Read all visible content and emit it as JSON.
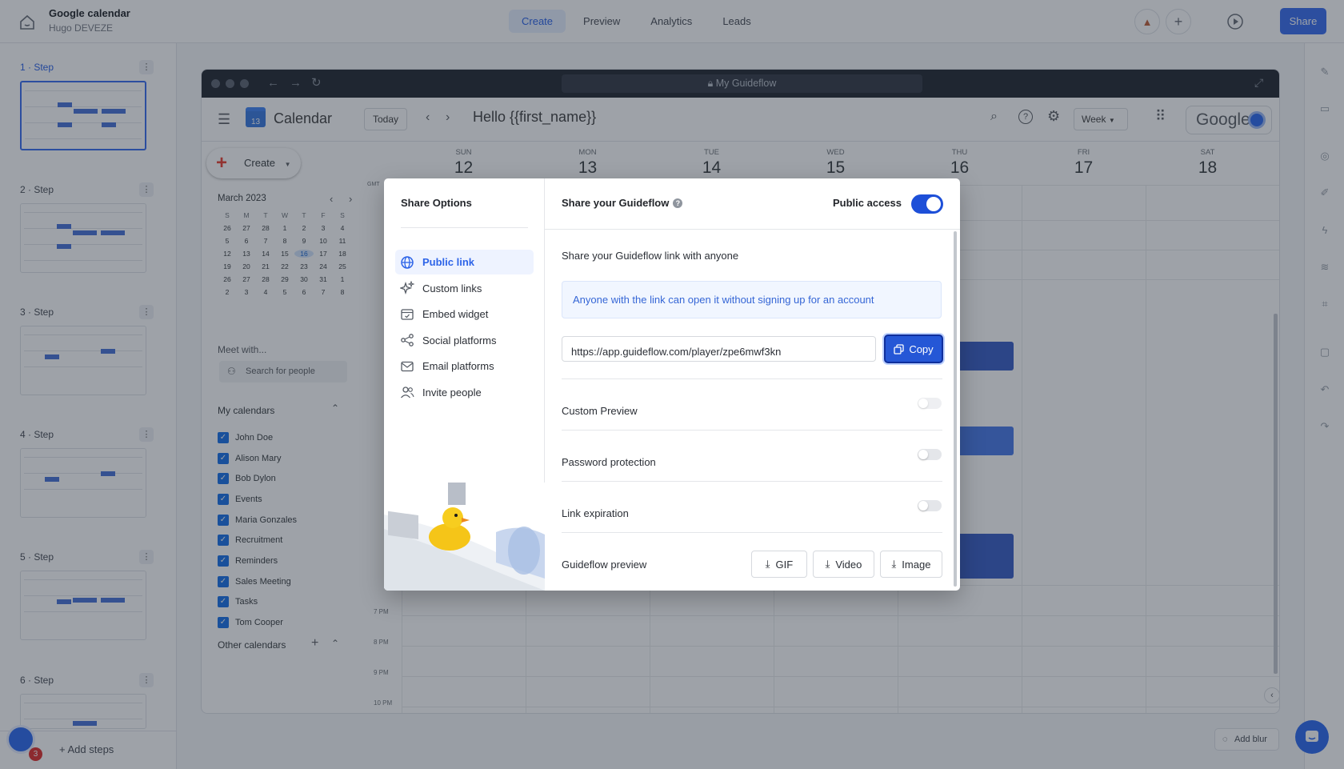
{
  "app": {
    "title": "Google calendar",
    "author": "Hugo DEVEZE"
  },
  "nav": {
    "tabs": [
      {
        "label": "Create"
      },
      {
        "label": "Preview"
      },
      {
        "label": "Analytics"
      },
      {
        "label": "Leads"
      }
    ],
    "active_tab": "Create"
  },
  "toolbar": {
    "share_label": "Share"
  },
  "steps": {
    "items": [
      {
        "label": "1 · Step"
      },
      {
        "label": "2 · Step"
      },
      {
        "label": "3 · Step"
      },
      {
        "label": "4 · Step"
      },
      {
        "label": "5 · Step"
      },
      {
        "label": "6 · Step"
      }
    ],
    "active_index": 0,
    "add_label": "+ Add steps",
    "notification_count": "3"
  },
  "browser": {
    "url": "My Guideflow"
  },
  "calendar": {
    "app_name": "Calendar",
    "today_label": "Today",
    "heading": "Hello {{first_name}}",
    "view_label": "Week",
    "brand": "Google",
    "create_label": "Create",
    "month_label": "March 2023",
    "weekday_initials": [
      "S",
      "M",
      "T",
      "W",
      "T",
      "F",
      "S"
    ],
    "mini_days": [
      "26",
      "27",
      "28",
      "1",
      "2",
      "3",
      "4",
      "5",
      "6",
      "7",
      "8",
      "9",
      "10",
      "11",
      "12",
      "13",
      "14",
      "15",
      "16",
      "17",
      "18",
      "19",
      "20",
      "21",
      "22",
      "23",
      "24",
      "25",
      "26",
      "27",
      "28",
      "29",
      "30",
      "31",
      "1",
      "2",
      "3",
      "4",
      "5",
      "6",
      "7",
      "8"
    ],
    "today_mini": "16",
    "meet_label": "Meet with...",
    "search_people_placeholder": "Search for people",
    "my_calendars_label": "My calendars",
    "calendars": [
      "John Doe",
      "Alison Mary",
      "Bob Dylon",
      "Events",
      "Maria Gonzales",
      "Recruitment",
      "Reminders",
      "Sales Meeting",
      "Tasks",
      "Tom Cooper"
    ],
    "other_calendars_label": "Other calendars",
    "timezone_label": "GMT",
    "days": [
      {
        "name": "SUN",
        "num": "12"
      },
      {
        "name": "MON",
        "num": "13"
      },
      {
        "name": "TUE",
        "num": "14"
      },
      {
        "name": "WED",
        "num": "15"
      },
      {
        "name": "THU",
        "num": "16"
      },
      {
        "name": "FRI",
        "num": "17"
      },
      {
        "name": "SAT",
        "num": "18"
      }
    ],
    "hours": [
      "7 PM",
      "8 PM",
      "9 PM",
      "10 PM"
    ]
  },
  "modal": {
    "title": "Share Options",
    "nav": [
      {
        "label": "Public link",
        "icon": "globe-icon"
      },
      {
        "label": "Custom links",
        "icon": "sparkles-icon"
      },
      {
        "label": "Embed widget",
        "icon": "embed-icon"
      },
      {
        "label": "Social platforms",
        "icon": "share-nodes-icon"
      },
      {
        "label": "Email platforms",
        "icon": "mail-icon"
      },
      {
        "label": "Invite people",
        "icon": "users-icon"
      }
    ],
    "active_nav": "Public link",
    "header_title": "Share your Guideflow",
    "public_access_label": "Public access",
    "public_access_on": true,
    "body_title": "Share your Guideflow link with anyone",
    "info_text": "Anyone with the link can open it without signing up for an account",
    "link_value": "https://app.guideflow.com/player/zpe6mwf3kn",
    "copy_label": "Copy",
    "options": [
      {
        "label": "Custom Preview",
        "enabled": false
      },
      {
        "label": "Password protection",
        "enabled": false
      },
      {
        "label": "Link expiration",
        "enabled": false
      }
    ],
    "preview_label": "Guideflow preview",
    "downloads": [
      {
        "label": "GIF"
      },
      {
        "label": "Video"
      },
      {
        "label": "Image"
      }
    ]
  },
  "footer": {
    "add_blur_label": "Add blur"
  },
  "colors": {
    "accent": "#2557d6",
    "brand_blue": "#3b6ff0",
    "badge_red": "#e0312f"
  }
}
